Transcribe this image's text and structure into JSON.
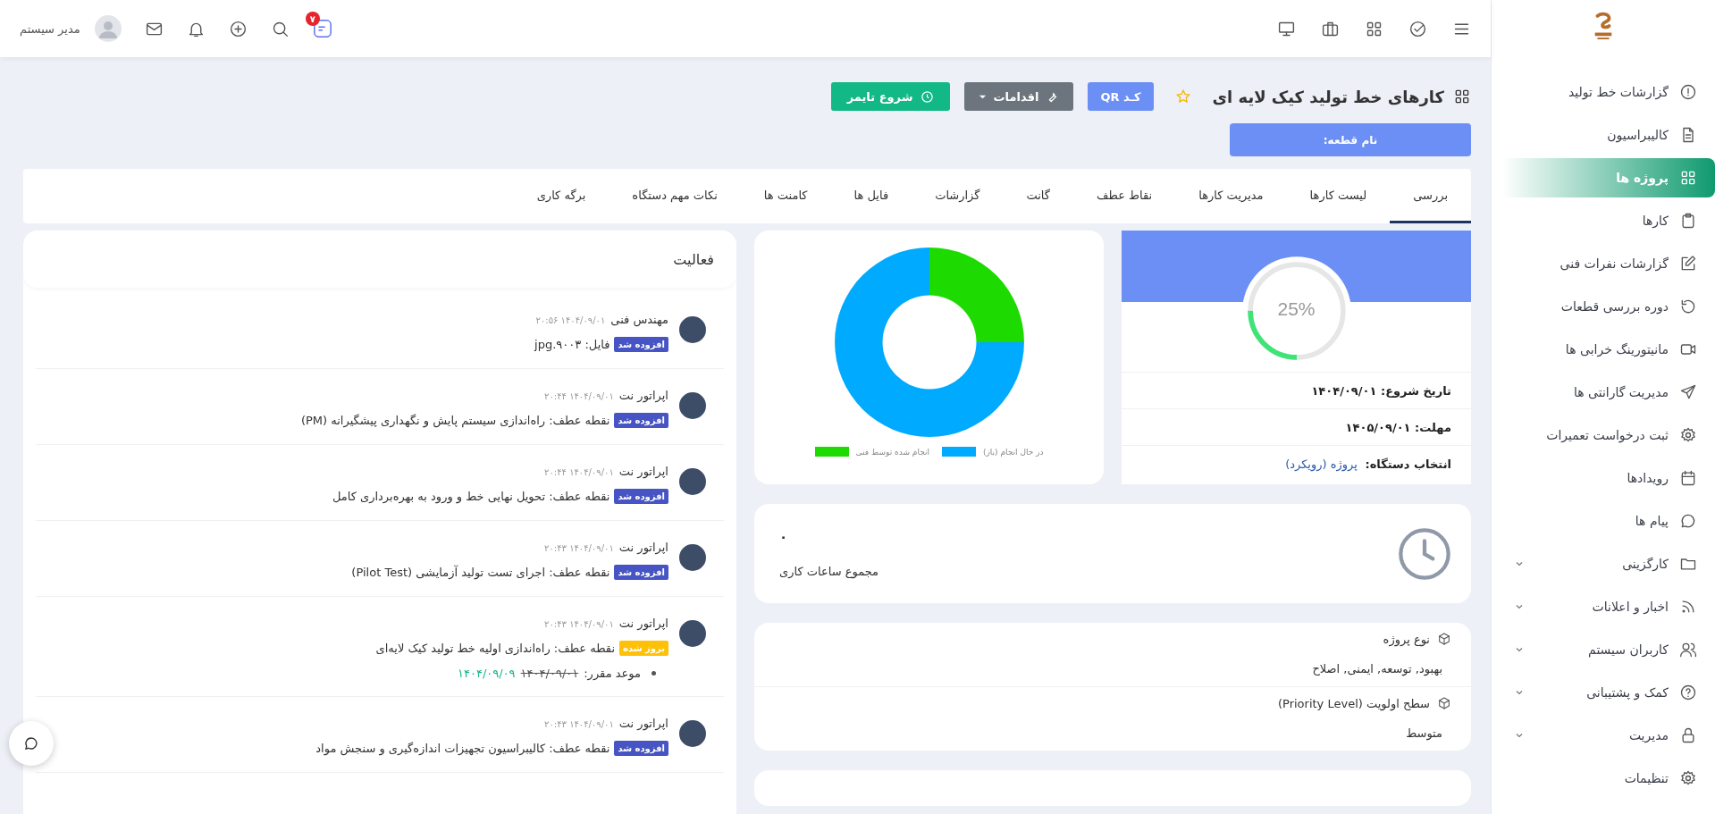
{
  "topbar": {
    "user_name": "مدیر سیستم",
    "notification_count": "۷"
  },
  "sidebar": {
    "items": [
      {
        "label": "گزارشات خط تولید",
        "selected": false,
        "expandable": false
      },
      {
        "label": "کالیبراسیون",
        "selected": false,
        "expandable": false
      },
      {
        "label": "پروژه ها",
        "selected": true,
        "expandable": false
      },
      {
        "label": "کارها",
        "selected": false,
        "expandable": false
      },
      {
        "label": "گزارشات نفرات فنی",
        "selected": false,
        "expandable": false
      },
      {
        "label": "دوره بررسی قطعات",
        "selected": false,
        "expandable": false
      },
      {
        "label": "مانیتورینگ خرابی ها",
        "selected": false,
        "expandable": false
      },
      {
        "label": "مدیریت گارانتی ها",
        "selected": false,
        "expandable": false
      },
      {
        "label": "ثبت درخواست تعمیرات",
        "selected": false,
        "expandable": false
      },
      {
        "label": "رویدادها",
        "selected": false,
        "expandable": false
      },
      {
        "label": "پیام ها",
        "selected": false,
        "expandable": false
      },
      {
        "label": "کارگزینی",
        "selected": false,
        "expandable": true
      },
      {
        "label": "اخبار و اعلانات",
        "selected": false,
        "expandable": true
      },
      {
        "label": "کاربران سیستم",
        "selected": false,
        "expandable": true
      },
      {
        "label": "کمک و پشتیبانی",
        "selected": false,
        "expandable": true
      },
      {
        "label": "مدیریت",
        "selected": false,
        "expandable": true
      },
      {
        "label": "تنظیمات",
        "selected": false,
        "expandable": false
      }
    ]
  },
  "header": {
    "title": "کارهای خط تولید کیک لایه ای",
    "favorite": false,
    "qr_button": "کـد QR",
    "actions_button": "اقدامات",
    "timer_button": "شروع تایمر",
    "part_name": "نام قطعه:"
  },
  "tabs": [
    {
      "label": "بررسی",
      "selected": true
    },
    {
      "label": "لیست کارها",
      "selected": false
    },
    {
      "label": "مدیریت کارها",
      "selected": false
    },
    {
      "label": "نقاط عطف",
      "selected": false
    },
    {
      "label": "گانت",
      "selected": false
    },
    {
      "label": "گزارشات",
      "selected": false
    },
    {
      "label": "فایل ها",
      "selected": false
    },
    {
      "label": "کامنت ها",
      "selected": false
    },
    {
      "label": "نکات مهم دستگاه",
      "selected": false
    },
    {
      "label": "برگه کاری",
      "selected": false
    }
  ],
  "progress_card": {
    "percent": "25%",
    "level": 0.25,
    "rows": [
      {
        "label": "تاریخ شروع:",
        "value": "۱۴۰۴/۰۹/۰۱"
      },
      {
        "label": "مهلت:",
        "value": "۱۴۰۵/۰۹/۰۱"
      },
      {
        "label": "انتخاب دستگاه:",
        "link": "پروژه (رویکرد)"
      }
    ]
  },
  "status_chart": {
    "chart_data": {
      "type": "donut",
      "categories": [
        "در حال انجام (باز)",
        "انجام شده توسط فنی"
      ],
      "values": [
        75,
        25
      ],
      "colors": [
        "#00aaff",
        "#1ddb00"
      ],
      "legend": "bottom"
    }
  },
  "hours_card": {
    "value": "۰",
    "label": "مجموع ساعات کاری"
  },
  "project_info": [
    {
      "label": "نوع پروژه",
      "value": "بهبود, توسعه, ایمنی, اصلاح"
    },
    {
      "label": "سطح اولویت (Priority Level)",
      "value": "متوسط"
    }
  ],
  "activity": {
    "title": "فعالیت",
    "items": [
      {
        "user": "مهندس فنی",
        "time": "۱۴۰۴/۰۹/۰۱ ۲۰:۵۶",
        "badge": "افزوده شد",
        "color": "#4654c4",
        "text": "فایل: ۹۰۰۳.jpg"
      },
      {
        "user": "اپراتور نت",
        "time": "۱۴۰۴/۰۹/۰۱ ۲۰:۴۴",
        "badge": "افزوده شد",
        "color": "#4654c4",
        "text": "نقطه عطف: راه‌اندازی سیستم پایش و نگهداری پیشگیرانه (PM)"
      },
      {
        "user": "اپراتور نت",
        "time": "۱۴۰۴/۰۹/۰۱ ۲۰:۴۴",
        "badge": "افزوده شد",
        "color": "#4654c4",
        "text": "نقطه عطف: تحویل نهایی خط و ورود به بهره‌برداری کامل"
      },
      {
        "user": "اپراتور نت",
        "time": "۱۴۰۴/۰۹/۰۱ ۲۰:۴۳",
        "badge": "افزوده شد",
        "color": "#4654c4",
        "text": "نقطه عطف: اجرای تست تولید آزمایشی (Pilot Test)"
      },
      {
        "user": "اپراتور نت",
        "time": "۱۴۰۴/۰۹/۰۱ ۲۰:۴۳",
        "badge": "بروز شده",
        "color": "#ffc107",
        "text": "نقطه عطف: راه‌اندازی اولیه خط تولید کیک لایه‌ای",
        "change": {
          "label": "موعد مقرر:",
          "old": "۱۴۰۴/۰۹/۰۱",
          "new": "۱۴۰۴/۰۹/۰۹"
        }
      },
      {
        "user": "اپراتور نت",
        "time": "۱۴۰۴/۰۹/۰۱ ۲۰:۴۳",
        "badge": "افزوده شد",
        "color": "#4654c4",
        "text": "نقطه عطف: کالیبراسیون تجهیزات اندازه‌گیری و سنجش مواد"
      }
    ]
  }
}
